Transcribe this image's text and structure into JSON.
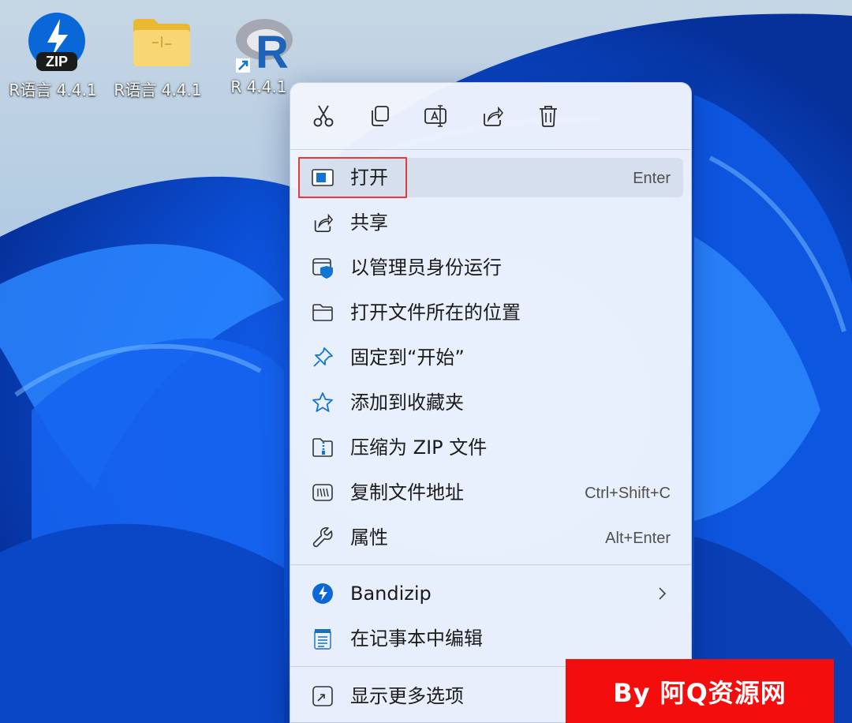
{
  "desktop": {
    "icons": [
      {
        "label": "R语言 4.4.1",
        "type": "zip-archive",
        "badge": "ZIP"
      },
      {
        "label": "R语言 4.4.1",
        "type": "folder"
      },
      {
        "label": "R 4.4.1",
        "type": "r-shortcut",
        "glyph": "R"
      }
    ]
  },
  "context_menu": {
    "toolbar": [
      {
        "name": "cut",
        "icon": "scissors-icon"
      },
      {
        "name": "copy",
        "icon": "copy-icon"
      },
      {
        "name": "rename",
        "icon": "rename-icon"
      },
      {
        "name": "share",
        "icon": "share-icon"
      },
      {
        "name": "delete",
        "icon": "trash-icon"
      }
    ],
    "items": [
      {
        "label": "打开",
        "shortcut": "Enter",
        "icon": "app-window-icon"
      },
      {
        "label": "共享",
        "shortcut": "",
        "icon": "share-icon"
      },
      {
        "label": "以管理员身份运行",
        "shortcut": "",
        "icon": "shield-admin-icon"
      },
      {
        "label": "打开文件所在的位置",
        "shortcut": "",
        "icon": "folder-icon"
      },
      {
        "label": "固定到“开始”",
        "shortcut": "",
        "icon": "pin-icon"
      },
      {
        "label": "添加到收藏夹",
        "shortcut": "",
        "icon": "star-icon"
      },
      {
        "label": "压缩为 ZIP 文件",
        "shortcut": "",
        "icon": "zip-folder-icon"
      },
      {
        "label": "复制文件地址",
        "shortcut": "Ctrl+Shift+C",
        "icon": "copy-path-icon"
      },
      {
        "label": "属性",
        "shortcut": "Alt+Enter",
        "icon": "wrench-icon"
      }
    ],
    "apps": [
      {
        "label": "Bandizip",
        "icon": "bandizip-icon",
        "has_submenu": true
      },
      {
        "label": "在记事本中编辑",
        "icon": "notepad-icon",
        "has_submenu": false
      }
    ],
    "more": {
      "label": "显示更多选项",
      "icon": "more-options-icon"
    }
  },
  "watermark": {
    "text": "By 阿Q资源网"
  },
  "colors": {
    "highlight": "#e53a3a",
    "accent": "#0a67d8",
    "watermark_bg": "#f30d0d"
  }
}
